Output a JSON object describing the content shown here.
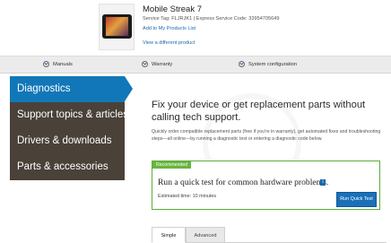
{
  "product": {
    "name": "Mobile Streak 7",
    "service_line": "Service Tag: FLJRJK1 | Express Service Code: 33954705649",
    "add_link": "Add to My Products List",
    "view_link": "View a different product"
  },
  "nav": {
    "manuals": "Manuals",
    "warranty": "Warranty",
    "system_config": "System configuration"
  },
  "sidebar": {
    "items": [
      {
        "label": "Diagnostics"
      },
      {
        "label": "Support topics & articles"
      },
      {
        "label": "Drivers & downloads"
      },
      {
        "label": "Parts & accessories"
      }
    ]
  },
  "main": {
    "title": "Fix your device or get replacement parts without calling tech support.",
    "description": "Quickly order compatible replacement parts (free if you're in warranty), get automated fixes and troubleshooting steps—all online—by running a diagnostic test or entering a diagnostic code below."
  },
  "recommended": {
    "badge": "Recommended",
    "title": "Run a quick test for common hardware problems.",
    "info": "i",
    "time": "Estimated time: 10 minutes",
    "button": "Run Quick Test"
  },
  "tabs": {
    "simple": "Simple",
    "advanced": "Advanced"
  },
  "colors": {
    "accent_blue": "#1277b8",
    "sidebar_bg": "#4a4139",
    "recommended_green": "#6ab43f"
  }
}
